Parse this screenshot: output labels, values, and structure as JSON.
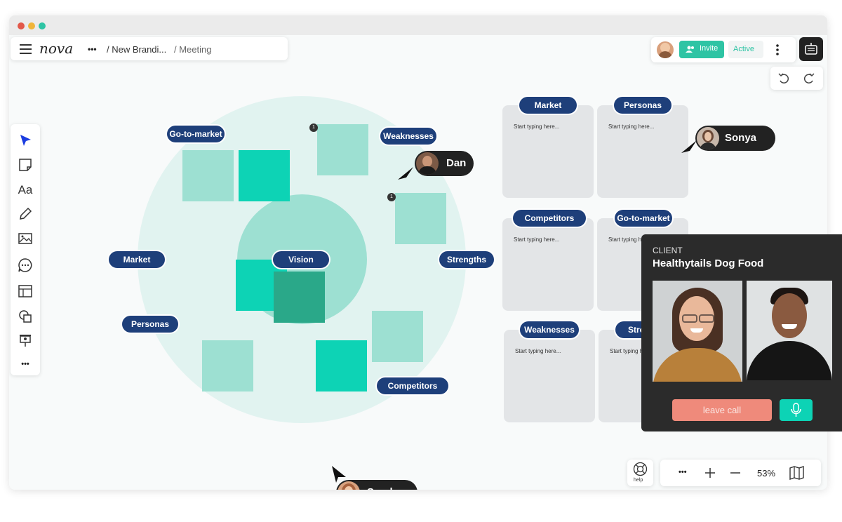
{
  "app": {
    "logo": "nova"
  },
  "breadcrumb": {
    "more": "•••",
    "project": "/ New Brandi...",
    "page": "/ Meeting"
  },
  "header": {
    "invite_label": "Invite",
    "status_label": "Active"
  },
  "canvas": {
    "labels": {
      "go_to_market": "Go-to-market",
      "weaknesses": "Weaknesses",
      "market": "Market",
      "vision": "Vision",
      "strengths": "Strengths",
      "personas": "Personas",
      "competitors": "Competitors"
    },
    "badge_value": "1",
    "cards": [
      {
        "title": "Market",
        "placeholder": "Start typing here..."
      },
      {
        "title": "Personas",
        "placeholder": "Start typing here..."
      },
      {
        "title": "Competitors",
        "placeholder": "Start typing here..."
      },
      {
        "title": "Go-to-market",
        "placeholder": "Start typing here..."
      },
      {
        "title": "Weaknesses",
        "placeholder": "Start typing here..."
      },
      {
        "title": "Stre",
        "placeholder": "Start typing h"
      }
    ]
  },
  "cursors": {
    "dan": "Dan",
    "sonya": "Sonya",
    "sarah": "Sarah"
  },
  "call": {
    "label": "CLIENT",
    "client_name": "Healthytails Dog Food",
    "leave_label": "leave call"
  },
  "toolbar": {
    "more": "•••",
    "zoom": "53%",
    "help_label": "help"
  },
  "sidebar_more": "•••",
  "colors": {
    "accent": "#0dd3b5",
    "navy": "#1e3f7a",
    "sticky_light": "#9de0d2",
    "sticky_dark": "#2aa889",
    "leave": "#ef8a7b"
  }
}
